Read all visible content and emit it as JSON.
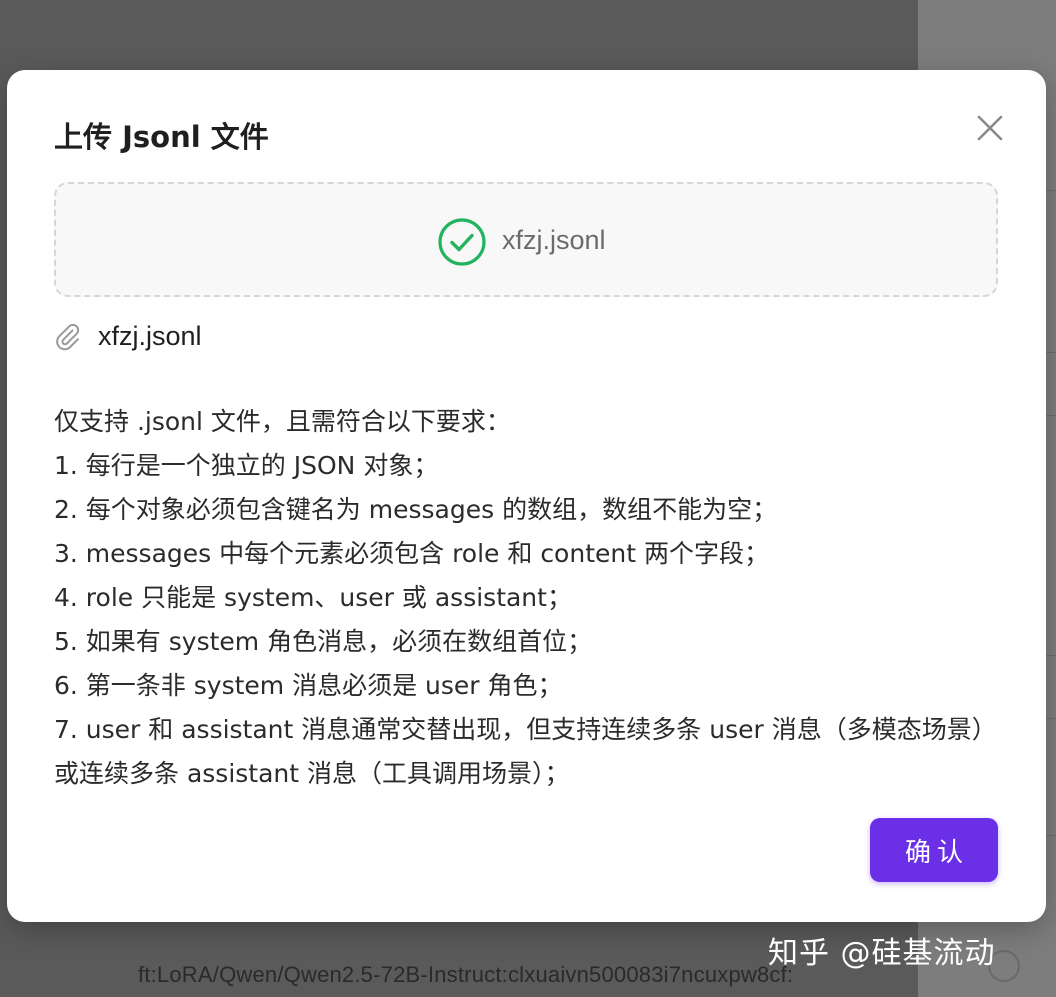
{
  "modal": {
    "title": "上传 Jsonl 文件",
    "close_icon": "close-icon",
    "dropzone": {
      "status_icon": "check-circle-icon",
      "status_color": "#22b35e",
      "filename": "xfzj.jsonl"
    },
    "uploaded_file": {
      "icon": "paperclip-icon",
      "name": "xfzj.jsonl"
    },
    "requirements": {
      "intro": "仅支持 .jsonl 文件，且需符合以下要求：",
      "items": [
        "1. 每行是一个独立的 JSON 对象；",
        "2. 每个对象必须包含键名为 messages 的数组，数组不能为空；",
        "3. messages 中每个元素必须包含 role 和 content 两个字段；",
        "4. role 只能是 system、user 或 assistant；",
        "5. 如果有 system 角色消息，必须在数组首位；",
        "6. 第一条非 system 消息必须是 user 角色；",
        "7. user 和 assistant 消息通常交替出现，但支持连续多条 user 消息（多模态场景）或连续多条 assistant 消息（工具调用场景）；"
      ]
    },
    "confirm_label": "确认",
    "accent_color": "#6a2fe6"
  },
  "background": {
    "model_id_text": "ft:LoRA/Qwen/Qwen2.5-72B-Instruct:clxuaivn500083i7ncuxpw8cf:"
  },
  "watermark": "知乎 @硅基流动"
}
